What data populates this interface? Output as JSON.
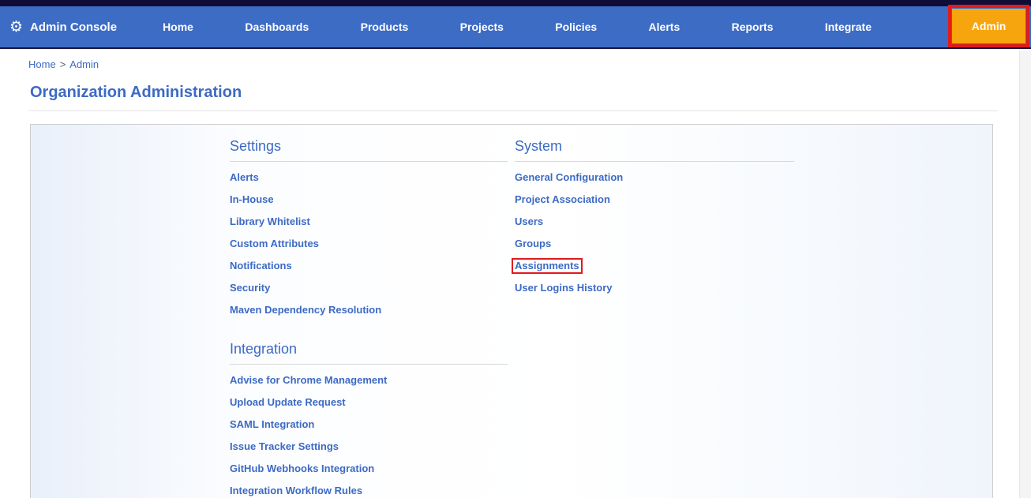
{
  "colors": {
    "top_strip_navy": "#0d0d38",
    "navbar_blue": "#3d6cc5",
    "link_blue": "#3c6ac4",
    "admin_button_orange": "#f7a50f",
    "annotation_red": "#e01b1b",
    "panel_tint_blue": "#e9f0fa"
  },
  "navbar": {
    "brand": {
      "label": "Admin Console",
      "icon": "gear-icon"
    },
    "items": [
      {
        "label": "Home"
      },
      {
        "label": "Dashboards"
      },
      {
        "label": "Products"
      },
      {
        "label": "Projects"
      },
      {
        "label": "Policies"
      },
      {
        "label": "Alerts"
      },
      {
        "label": "Reports"
      },
      {
        "label": "Integrate"
      }
    ],
    "admin_button": {
      "label": "Admin",
      "highlighted": true,
      "annotated_with_red_box": true
    }
  },
  "breadcrumb": {
    "separator": ">",
    "items": [
      {
        "label": "Home"
      },
      {
        "label": "Admin"
      }
    ]
  },
  "page": {
    "title": "Organization Administration"
  },
  "panel": {
    "columns": [
      {
        "sections": [
          {
            "title": "Settings",
            "links": [
              {
                "label": "Alerts"
              },
              {
                "label": "In-House"
              },
              {
                "label": "Library Whitelist"
              },
              {
                "label": "Custom Attributes"
              },
              {
                "label": "Notifications"
              },
              {
                "label": "Security"
              },
              {
                "label": "Maven Dependency Resolution"
              }
            ]
          },
          {
            "title": "Integration",
            "links": [
              {
                "label": "Advise for Chrome Management"
              },
              {
                "label": "Upload Update Request"
              },
              {
                "label": "SAML Integration"
              },
              {
                "label": "Issue Tracker Settings"
              },
              {
                "label": "GitHub Webhooks Integration"
              },
              {
                "label": "Integration Workflow Rules"
              }
            ]
          }
        ]
      },
      {
        "sections": [
          {
            "title": "System",
            "links": [
              {
                "label": "General Configuration"
              },
              {
                "label": "Project Association"
              },
              {
                "label": "Users"
              },
              {
                "label": "Groups"
              },
              {
                "label": "Assignments",
                "annotated_with_red_box": true
              },
              {
                "label": "User Logins History"
              }
            ]
          }
        ]
      }
    ]
  }
}
